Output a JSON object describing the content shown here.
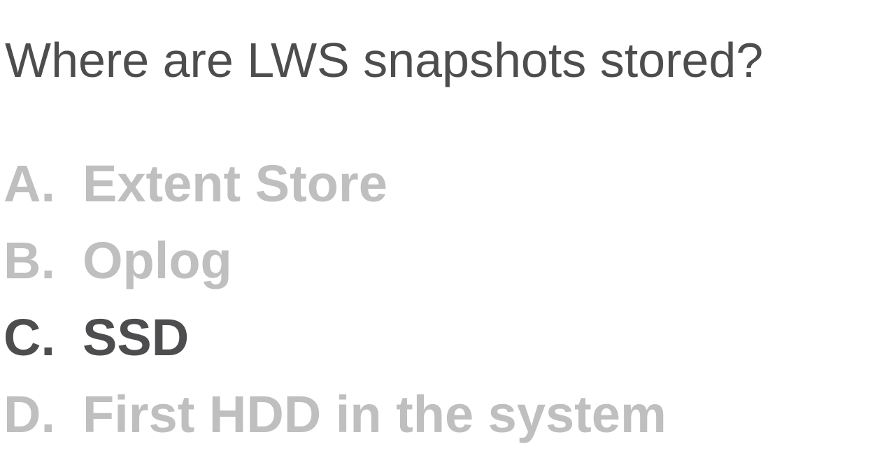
{
  "question": "Where are LWS snapshots stored?",
  "options": [
    {
      "letter": "A.",
      "text": "Extent Store",
      "highlighted": false
    },
    {
      "letter": "B.",
      "text": "Oplog",
      "highlighted": false
    },
    {
      "letter": "C.",
      "text": "SSD",
      "highlighted": true
    },
    {
      "letter": "D.",
      "text": "First HDD in the system",
      "highlighted": false
    }
  ],
  "colors": {
    "question": "#4d4d4f",
    "highlighted_option": "#4d4d4f",
    "dimmed_option": "#bfbfbf",
    "background": "#ffffff"
  }
}
